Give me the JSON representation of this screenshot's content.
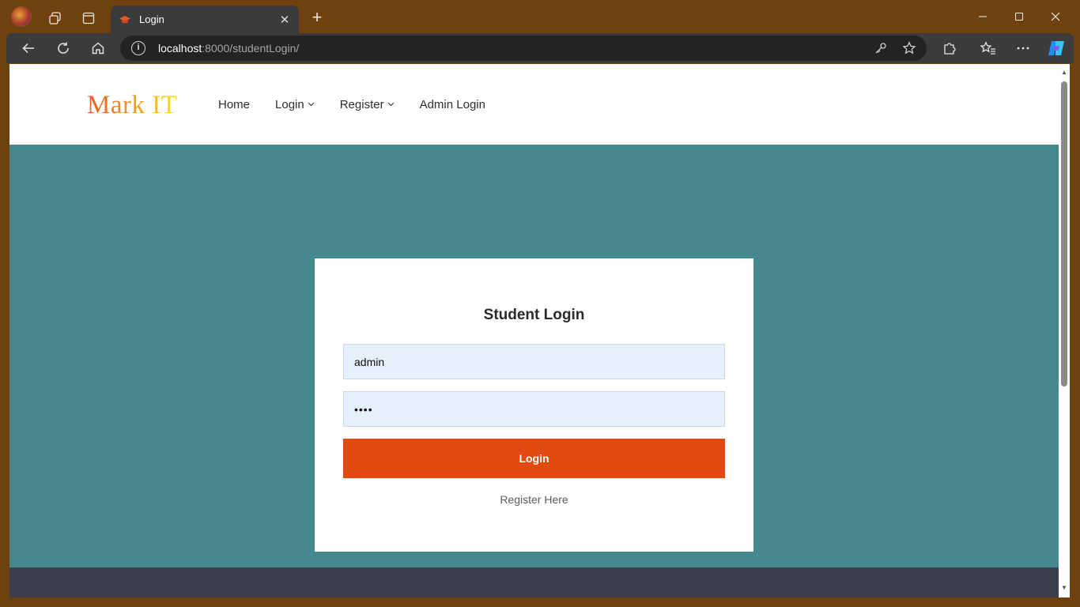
{
  "browser": {
    "tab_title": "Login",
    "url_host": "localhost",
    "url_path": ":8000/studentLogin/"
  },
  "site": {
    "brand": "Mark IT",
    "nav": {
      "home": "Home",
      "login": "Login",
      "register": "Register",
      "admin_login": "Admin Login"
    }
  },
  "login_form": {
    "title": "Student Login",
    "username_value": "admin",
    "password_value": "••••",
    "submit_label": "Login",
    "register_link": "Register Here"
  },
  "colors": {
    "hero_bg": "#45898f",
    "login_button": "#e24a12",
    "footer_bg": "#3b3f4b",
    "titlebar": "#6e410f"
  },
  "icons": {
    "back": "back-arrow-icon",
    "refresh": "refresh-icon",
    "home": "home-icon",
    "info": "info-icon",
    "key": "key-icon",
    "favorite": "star-icon",
    "extensions": "puzzle-icon",
    "favorites": "favorites-icon",
    "more": "more-icon",
    "copilot": "copilot-icon"
  }
}
